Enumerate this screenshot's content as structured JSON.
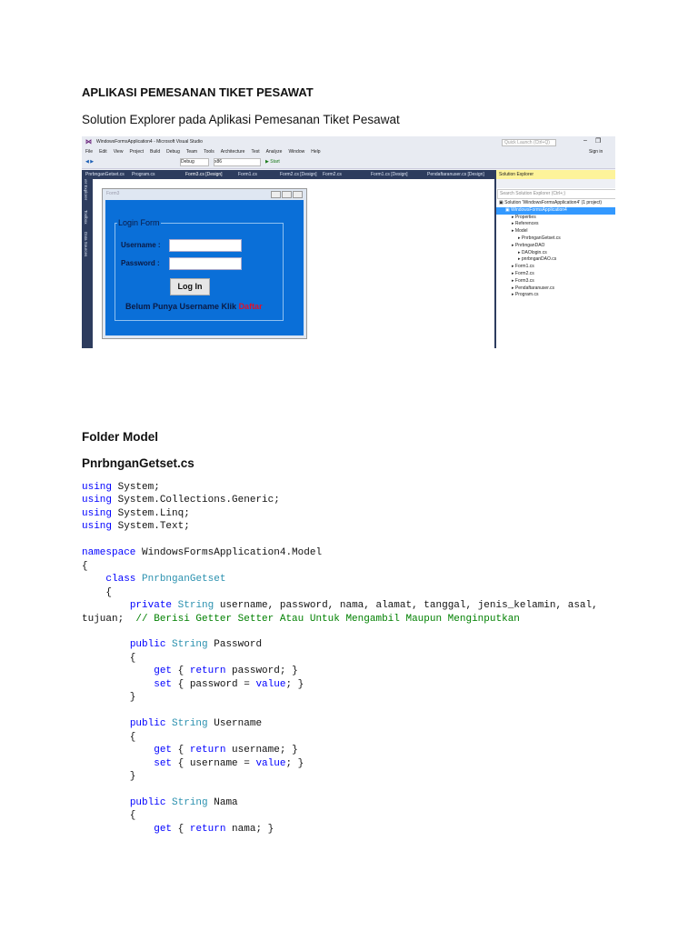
{
  "title": "APLIKASI PEMESANAN TIKET PESAWAT",
  "subtitle": "Solution Explorer pada Aplikasi Pemesanan Tiket Pesawat",
  "screenshot": {
    "window_title": "WindowsFormsApplication4 - Microsoft Visual Studio",
    "quick_launch": "Quick Launch (Ctrl+Q)",
    "sign_in": "Sign in",
    "menu": [
      "File",
      "Edit",
      "View",
      "Project",
      "Build",
      "Debug",
      "Team",
      "Tools",
      "Architecture",
      "Test",
      "Analyze",
      "Window",
      "Help"
    ],
    "config": "Debug",
    "platform": "x86",
    "start": "▶ Start",
    "tabs": [
      "PnrbnganGetset.cs",
      "Program.cs",
      "Form3.cs [Design]",
      "Form1.cs",
      "Form2.cs [Design]",
      "Form2.cs",
      "Form1.cs [Design]",
      "Pendaftaranuser.cs [Design]"
    ],
    "side_tabs": [
      "Server Explorer",
      "Toolbox",
      "Data Sources"
    ],
    "form": {
      "title": "Form3",
      "group": "Login Form",
      "username": "Username :",
      "password": "Password :",
      "login": "Log In",
      "register_text": "Belum Punya Username Klik",
      "register_link": "Daftar"
    },
    "solution_explorer": {
      "title": "Solution Explorer",
      "search": "Search Solution Explorer (Ctrl+;)",
      "items": [
        {
          "label": "Solution 'WindowsFormsApplication4' (1 project)",
          "indent": 0
        },
        {
          "label": "WindowsFormsApplication4",
          "indent": 1,
          "selected": true
        },
        {
          "label": "Properties",
          "indent": 2
        },
        {
          "label": "References",
          "indent": 2
        },
        {
          "label": "Model",
          "indent": 2
        },
        {
          "label": "PnrbnganGetset.cs",
          "indent": 3
        },
        {
          "label": "PnrbnganDAO",
          "indent": 2
        },
        {
          "label": "DAOlogin.cs",
          "indent": 3
        },
        {
          "label": "pnrbnganDAO.cs",
          "indent": 3
        },
        {
          "label": "Form1.cs",
          "indent": 2
        },
        {
          "label": "Form2.cs",
          "indent": 2
        },
        {
          "label": "Form3.cs",
          "indent": 2
        },
        {
          "label": "Pendaftaranuser.cs",
          "indent": 2
        },
        {
          "label": "Program.cs",
          "indent": 2
        }
      ]
    }
  },
  "section": "Folder Model",
  "file": "PnrbnganGetset.cs",
  "code": {
    "lines": [
      [
        [
          "using",
          "kw"
        ],
        [
          " System;",
          ""
        ]
      ],
      [
        [
          "using",
          "kw"
        ],
        [
          " System.Collections.Generic;",
          ""
        ]
      ],
      [
        [
          "using",
          "kw"
        ],
        [
          " System.Linq;",
          ""
        ]
      ],
      [
        [
          "using",
          "kw"
        ],
        [
          " System.Text;",
          ""
        ]
      ],
      [],
      [
        [
          "namespace",
          "kw"
        ],
        [
          " WindowsFormsApplication4.Model",
          ""
        ]
      ],
      [
        [
          "{",
          ""
        ]
      ],
      [
        [
          "    ",
          ""
        ],
        [
          "class",
          "kw"
        ],
        [
          " ",
          ""
        ],
        [
          "PnrbnganGetset",
          "ty"
        ]
      ],
      [
        [
          "    {",
          ""
        ]
      ],
      [
        [
          "        ",
          ""
        ],
        [
          "private",
          "kw"
        ],
        [
          " ",
          ""
        ],
        [
          "String",
          "ty"
        ],
        [
          " username, password, nama, alamat, tanggal, jenis_kelamin, asal,",
          ""
        ]
      ],
      [
        [
          "tujuan;  ",
          ""
        ],
        [
          "// Berisi Getter Setter Atau Untuk Mengambil Maupun Menginputkan",
          "cm"
        ]
      ],
      [],
      [
        [
          "        ",
          ""
        ],
        [
          "public",
          "kw"
        ],
        [
          " ",
          ""
        ],
        [
          "String",
          "ty"
        ],
        [
          " Password",
          ""
        ]
      ],
      [
        [
          "        {",
          ""
        ]
      ],
      [
        [
          "            ",
          ""
        ],
        [
          "get",
          "kw"
        ],
        [
          " { ",
          ""
        ],
        [
          "return",
          "kw"
        ],
        [
          " password; }",
          ""
        ]
      ],
      [
        [
          "            ",
          ""
        ],
        [
          "set",
          "kw"
        ],
        [
          " { password = ",
          ""
        ],
        [
          "value",
          "kw"
        ],
        [
          "; }",
          ""
        ]
      ],
      [
        [
          "        }",
          ""
        ]
      ],
      [],
      [
        [
          "        ",
          ""
        ],
        [
          "public",
          "kw"
        ],
        [
          " ",
          ""
        ],
        [
          "String",
          "ty"
        ],
        [
          " Username",
          ""
        ]
      ],
      [
        [
          "        {",
          ""
        ]
      ],
      [
        [
          "            ",
          ""
        ],
        [
          "get",
          "kw"
        ],
        [
          " { ",
          ""
        ],
        [
          "return",
          "kw"
        ],
        [
          " username; }",
          ""
        ]
      ],
      [
        [
          "            ",
          ""
        ],
        [
          "set",
          "kw"
        ],
        [
          " { username = ",
          ""
        ],
        [
          "value",
          "kw"
        ],
        [
          "; }",
          ""
        ]
      ],
      [
        [
          "        }",
          ""
        ]
      ],
      [],
      [
        [
          "        ",
          ""
        ],
        [
          "public",
          "kw"
        ],
        [
          " ",
          ""
        ],
        [
          "String",
          "ty"
        ],
        [
          " Nama",
          ""
        ]
      ],
      [
        [
          "        {",
          ""
        ]
      ],
      [
        [
          "            ",
          ""
        ],
        [
          "get",
          "kw"
        ],
        [
          " { ",
          ""
        ],
        [
          "return",
          "kw"
        ],
        [
          " nama; }",
          ""
        ]
      ]
    ]
  }
}
